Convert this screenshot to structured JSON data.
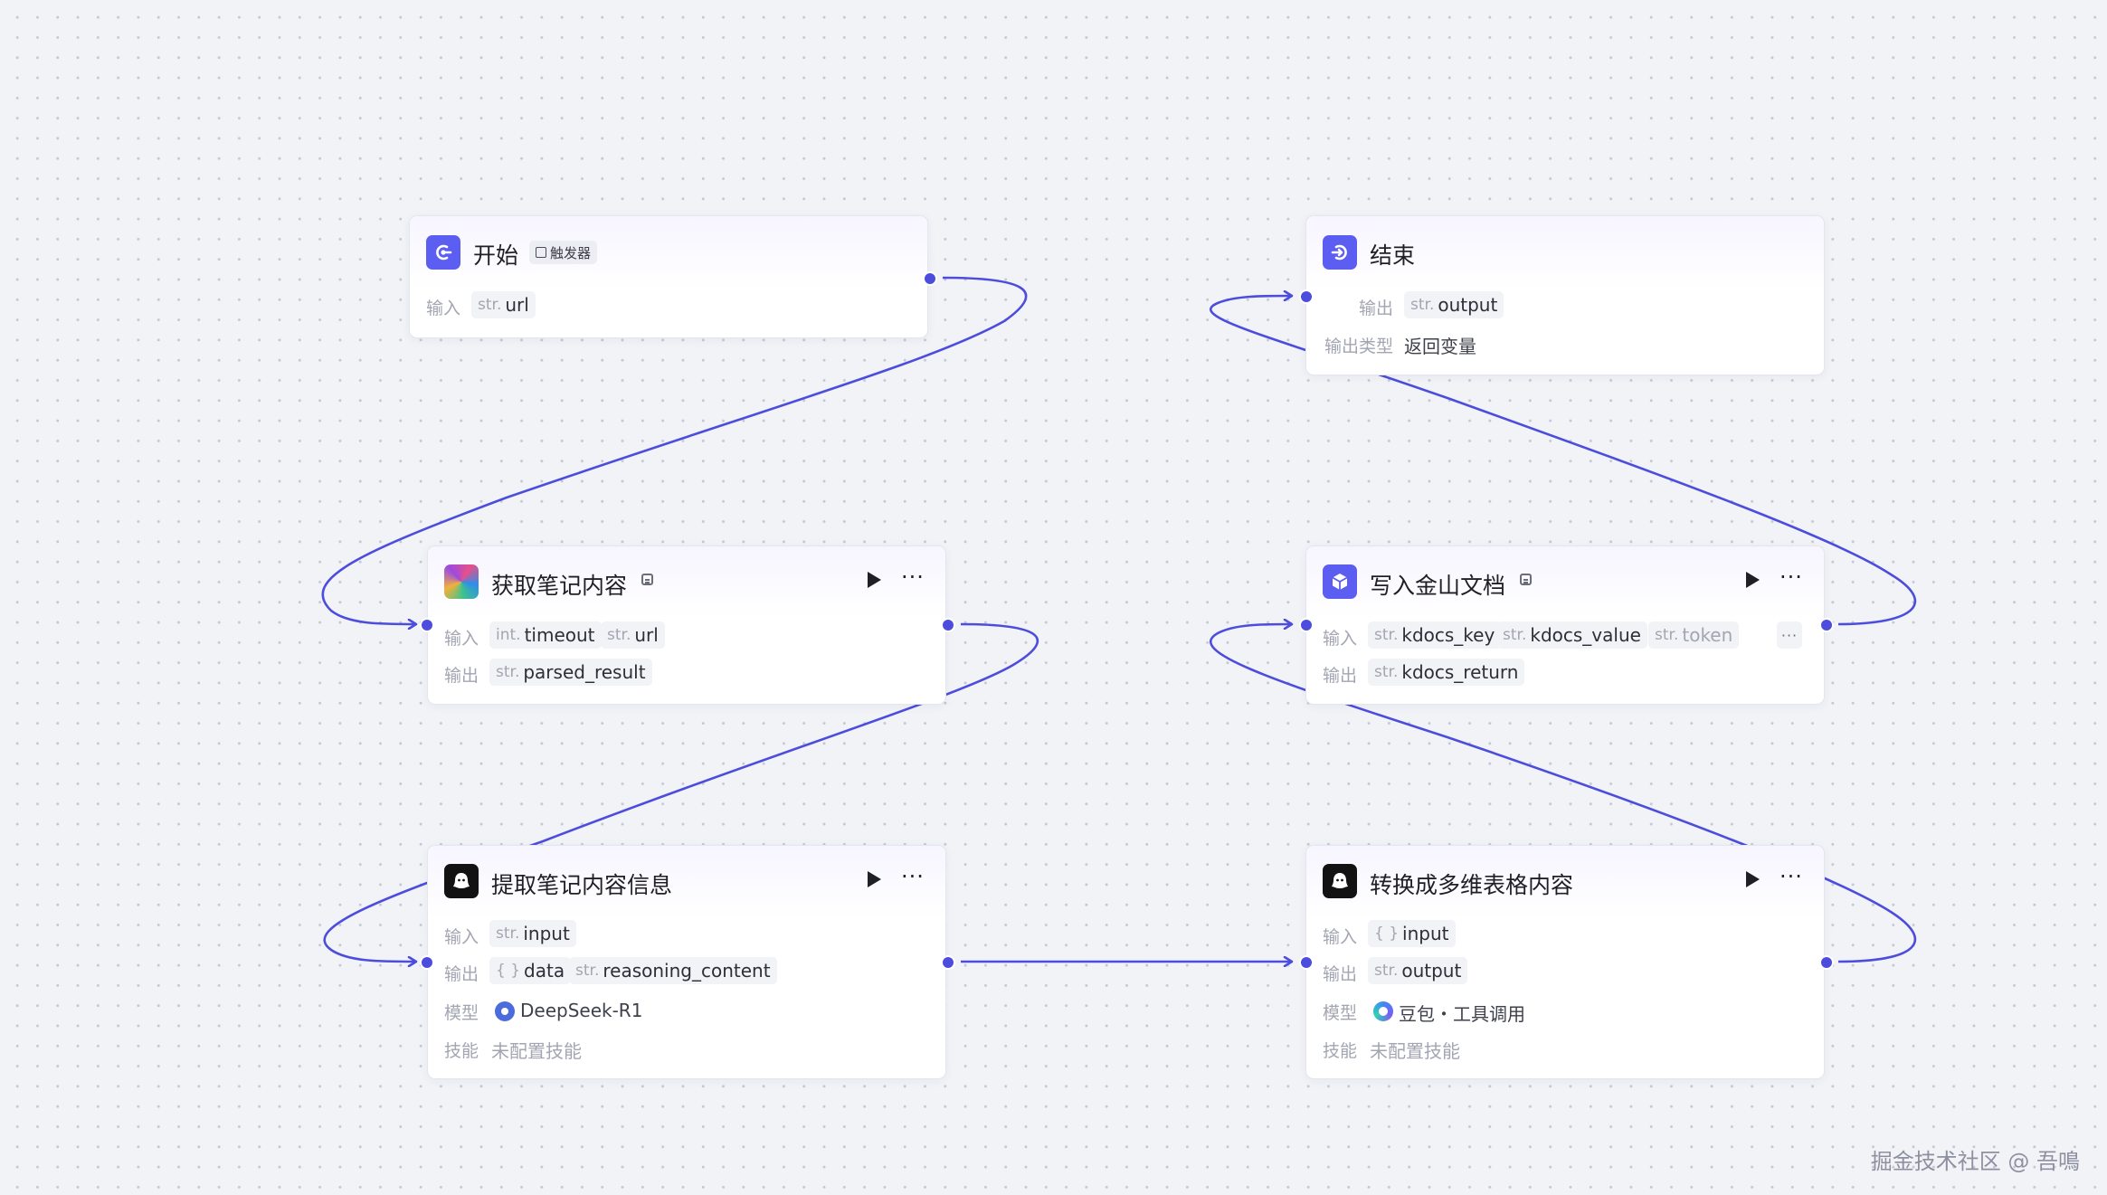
{
  "nodes": {
    "start": {
      "title": "开始",
      "badge": "触发器",
      "input_label": "输入",
      "inputs": [
        {
          "type": "str.",
          "name": "url"
        }
      ]
    },
    "end": {
      "title": "结束",
      "output_label": "输出",
      "outputs": [
        {
          "type": "str.",
          "name": "output"
        }
      ],
      "output_type_label": "输出类型",
      "output_type_value": "返回变量"
    },
    "fetch": {
      "title": "获取笔记内容",
      "input_label": "输入",
      "output_label": "输出",
      "inputs": [
        {
          "type": "int.",
          "name": "timeout"
        },
        {
          "type": "str.",
          "name": "url"
        }
      ],
      "outputs": [
        {
          "type": "str.",
          "name": "parsed_result"
        }
      ]
    },
    "write": {
      "title": "写入金山文档",
      "input_label": "输入",
      "output_label": "输出",
      "inputs": [
        {
          "type": "str.",
          "name": "kdocs_key"
        },
        {
          "type": "str.",
          "name": "kdocs_value"
        },
        {
          "type": "str.",
          "name": "token"
        }
      ],
      "more_inputs": "···",
      "outputs": [
        {
          "type": "str.",
          "name": "kdocs_return"
        }
      ]
    },
    "extract": {
      "title": "提取笔记内容信息",
      "input_label": "输入",
      "output_label": "输出",
      "model_label": "模型",
      "skill_label": "技能",
      "inputs": [
        {
          "type": "str.",
          "name": "input"
        }
      ],
      "outputs": [
        {
          "type": "{ }",
          "name": "data"
        },
        {
          "type": "str.",
          "name": "reasoning_content"
        }
      ],
      "model": "DeepSeek-R1",
      "skill": "未配置技能"
    },
    "convert": {
      "title": "转换成多维表格内容",
      "input_label": "输入",
      "output_label": "输出",
      "model_label": "模型",
      "skill_label": "技能",
      "inputs": [
        {
          "type": "{ }",
          "name": "input"
        }
      ],
      "outputs": [
        {
          "type": "str.",
          "name": "output"
        }
      ],
      "model": "豆包・工具调用",
      "skill": "未配置技能"
    }
  },
  "menu_dots": "···",
  "watermark": "掘金技术社区 @ 吾鳴",
  "colors": {
    "edge": "#4d4ddd",
    "background": "#f2f3f7",
    "accent": "#5b5ef0"
  }
}
